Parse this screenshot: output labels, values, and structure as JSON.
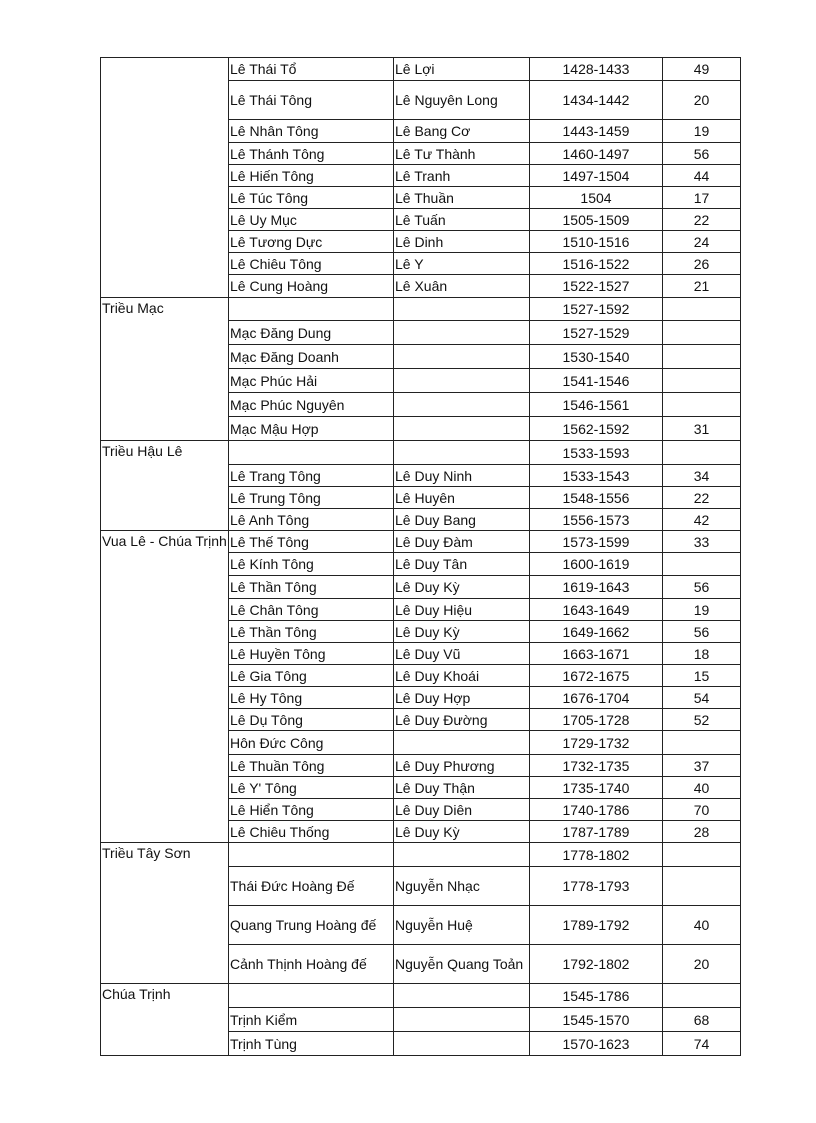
{
  "table": {
    "groups": [
      {
        "label": "",
        "rows": [
          [
            "Lê Thái Tổ",
            "Lê Lợi",
            "1428-1433",
            "49"
          ],
          [
            "Lê Thái Tông",
            "Lê Nguyên Long",
            "1434-1442",
            "20"
          ],
          [
            "Lê Nhân Tông",
            "Lê Bang Cơ",
            "1443-1459",
            "19"
          ],
          [
            "Lê Thánh Tông",
            "Lê Tư Thành",
            "1460-1497",
            "56"
          ],
          [
            "Lê Hiến Tông",
            "Lê Tranh",
            "1497-1504",
            "44"
          ],
          [
            "Lê Túc Tông",
            "Lê Thuần",
            "1504",
            "17"
          ],
          [
            "Lê Uy Mục",
            "Lê Tuấn",
            "1505-1509",
            "22"
          ],
          [
            "Lê Tương Dực",
            "Lê Dinh",
            "1510-1516",
            "24"
          ],
          [
            "Lê Chiêu Tông",
            "Lê Y",
            "1516-1522",
            "26"
          ],
          [
            "Lê Cung Hoàng",
            "Lê Xuân",
            "1522-1527",
            "21"
          ]
        ]
      },
      {
        "label": "Triều Mạc",
        "rows": [
          [
            "",
            "",
            "1527-1592",
            ""
          ],
          [
            "Mạc Đăng Dung",
            "",
            "1527-1529",
            ""
          ],
          [
            "Mạc Đăng Doanh",
            "",
            "1530-1540",
            ""
          ],
          [
            "Mạc Phúc Hải",
            "",
            "1541-1546",
            ""
          ],
          [
            "Mạc Phúc Nguyên",
            "",
            "1546-1561",
            ""
          ],
          [
            "Mạc Mậu Hợp",
            "",
            "1562-1592",
            "31"
          ]
        ]
      },
      {
        "label": "Triều Hậu Lê",
        "rows": [
          [
            "",
            "",
            "1533-1593",
            ""
          ],
          [
            "Lê Trang Tông",
            "Lê Duy Ninh",
            "1533-1543",
            "34"
          ],
          [
            "Lê Trung Tông",
            "Lê Huyên",
            "1548-1556",
            "22"
          ],
          [
            "Lê Anh Tông",
            "Lê Duy Bang",
            "1556-1573",
            "42"
          ]
        ]
      },
      {
        "label": "Vua Lê - Chúa Trịnh",
        "rows": [
          [
            "Lê Thế Tông",
            "Lê Duy Đàm",
            "1573-1599",
            "33"
          ],
          [
            "Lê Kính Tông",
            "Lê Duy Tân",
            "1600-1619",
            ""
          ],
          [
            "Lê Thần Tông",
            "Lê Duy Kỳ",
            "1619-1643",
            "56"
          ],
          [
            "Lê Chân Tông",
            "Lê Duy Hiệu",
            "1643-1649",
            "19"
          ],
          [
            "Lê Thần Tông",
            "Lê Duy Kỳ",
            "1649-1662",
            "56"
          ],
          [
            "Lê Huyền Tông",
            "Lê Duy Vũ",
            "1663-1671",
            "18"
          ],
          [
            "Lê Gia Tông",
            "Lê Duy Khoái",
            "1672-1675",
            "15"
          ],
          [
            "Lê Hy Tông",
            "Lê Duy Hợp",
            "1676-1704",
            "54"
          ],
          [
            "Lê Dụ Tông",
            "Lê Duy Đường",
            "1705-1728",
            "52"
          ],
          [
            "Hôn Đức Công",
            "",
            "1729-1732",
            ""
          ],
          [
            "Lê Thuần Tông",
            "Lê Duy Phương",
            "1732-1735",
            "37"
          ],
          [
            "Lê Y' Tông",
            "Lê Duy Thận",
            "1735-1740",
            "40"
          ],
          [
            "Lê Hiển Tông",
            "Lê Duy Diên",
            "1740-1786",
            "70"
          ],
          [
            "Lê Chiêu Thống",
            "Lê Duy Kỳ",
            "1787-1789",
            "28"
          ]
        ]
      },
      {
        "label": "Triều Tây Sơn",
        "rows": [
          [
            "",
            "",
            "1778-1802",
            ""
          ],
          [
            "Thái Đức Hoàng Đế",
            "Nguyễn Nhạc",
            "1778-1793",
            ""
          ],
          [
            "Quang Trung Hoàng đế",
            "Nguyễn Huệ",
            "1789-1792",
            "40"
          ],
          [
            "Cảnh Thịnh Hoàng đế",
            "Nguyễn Quang Toản",
            "1792-1802",
            "20"
          ]
        ]
      },
      {
        "label": "Chúa Trịnh",
        "rows": [
          [
            "",
            "",
            "1545-1786",
            ""
          ],
          [
            "Trịnh Kiểm",
            "",
            "1545-1570",
            "68"
          ],
          [
            "Trịnh Tùng",
            "",
            "1570-1623",
            "74"
          ]
        ]
      }
    ]
  }
}
